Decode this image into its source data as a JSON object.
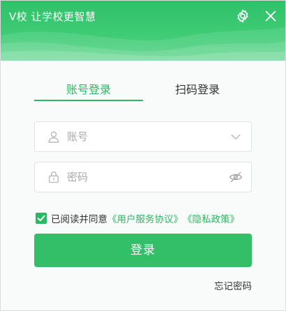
{
  "window": {
    "title": "V校 让学校更智慧",
    "icons": {
      "settings": "gear-icon",
      "close": "close-icon"
    }
  },
  "tabs": [
    {
      "label": "账号登录",
      "active": true
    },
    {
      "label": "扫码登录",
      "active": false
    }
  ],
  "account_field": {
    "placeholder": "账号",
    "value": "",
    "lead_icon": "user-icon",
    "trail_icon": "chevron-down-icon"
  },
  "password_field": {
    "placeholder": "密码",
    "value": "",
    "lead_icon": "lock-icon",
    "trail_icon": "eye-icon"
  },
  "agreement": {
    "checked": true,
    "prefix": "已阅读并同意",
    "user_agreement": "《用户服务协议》",
    "privacy_policy": "《隐私政策》"
  },
  "login_button": {
    "label": "登录"
  },
  "forgot_password": {
    "label": "忘记密码"
  },
  "colors": {
    "brand_green": "#2bb863",
    "header_green": "#3ecb74",
    "button_green": "#33bf67",
    "text_dark": "#333333",
    "placeholder": "#a9a9a9"
  }
}
